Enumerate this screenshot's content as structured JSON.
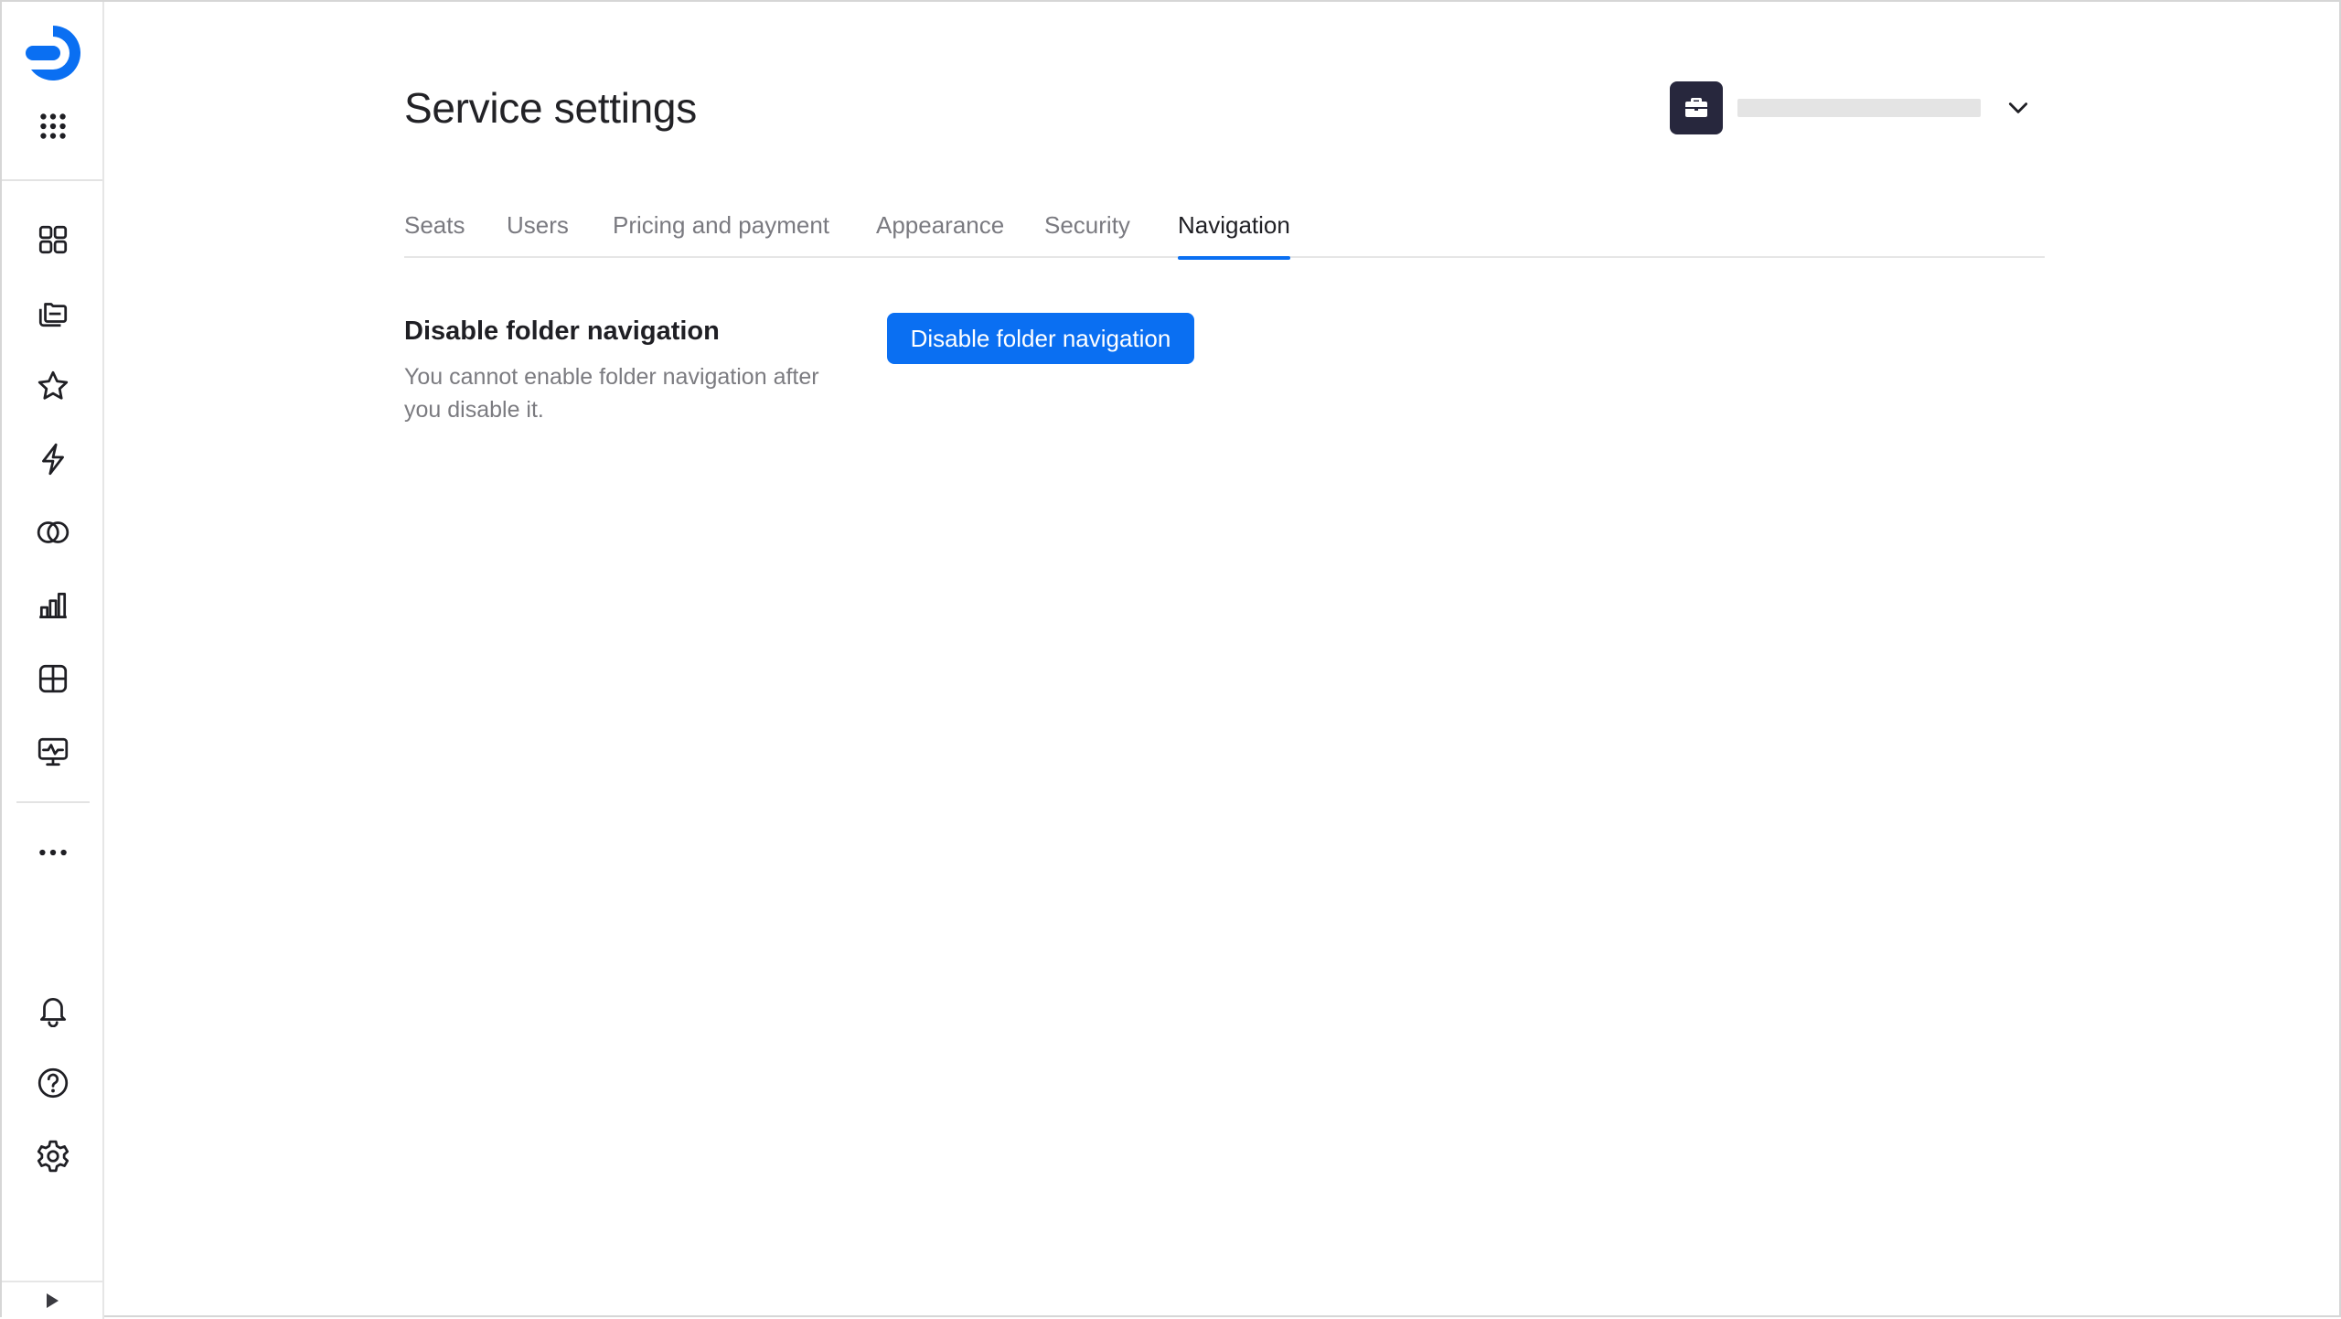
{
  "app": {
    "brand_color": "#0a6ff2",
    "logo_icon": "datalens-logo"
  },
  "sidebar": {
    "top_items": [
      {
        "icon": "apps-grid-icon"
      },
      {
        "icon": "dashboard-icon"
      },
      {
        "icon": "collections-icon"
      },
      {
        "icon": "star-icon"
      },
      {
        "icon": "lightning-icon"
      },
      {
        "icon": "connections-icon"
      },
      {
        "icon": "charts-icon"
      },
      {
        "icon": "datasets-icon"
      },
      {
        "icon": "monitoring-icon"
      },
      {
        "icon": "more-icon"
      }
    ],
    "bottom_items": [
      {
        "icon": "bell-icon"
      },
      {
        "icon": "help-icon"
      },
      {
        "icon": "gear-icon"
      }
    ],
    "expand_icon": "expand-arrow-icon"
  },
  "header": {
    "title": "Service settings",
    "workspace_icon": "briefcase-icon",
    "workspace_avatar_color": "#27273d"
  },
  "tabs": [
    {
      "label": "Seats",
      "active": false
    },
    {
      "label": "Users",
      "active": false
    },
    {
      "label": "Pricing and payment",
      "active": false
    },
    {
      "label": "Appearance",
      "active": false
    },
    {
      "label": "Security",
      "active": false
    },
    {
      "label": "Navigation",
      "active": true
    }
  ],
  "navigation_section": {
    "title": "Disable folder navigation",
    "description": "You cannot enable folder navigation after you disable it.",
    "button_label": "Disable folder navigation"
  }
}
